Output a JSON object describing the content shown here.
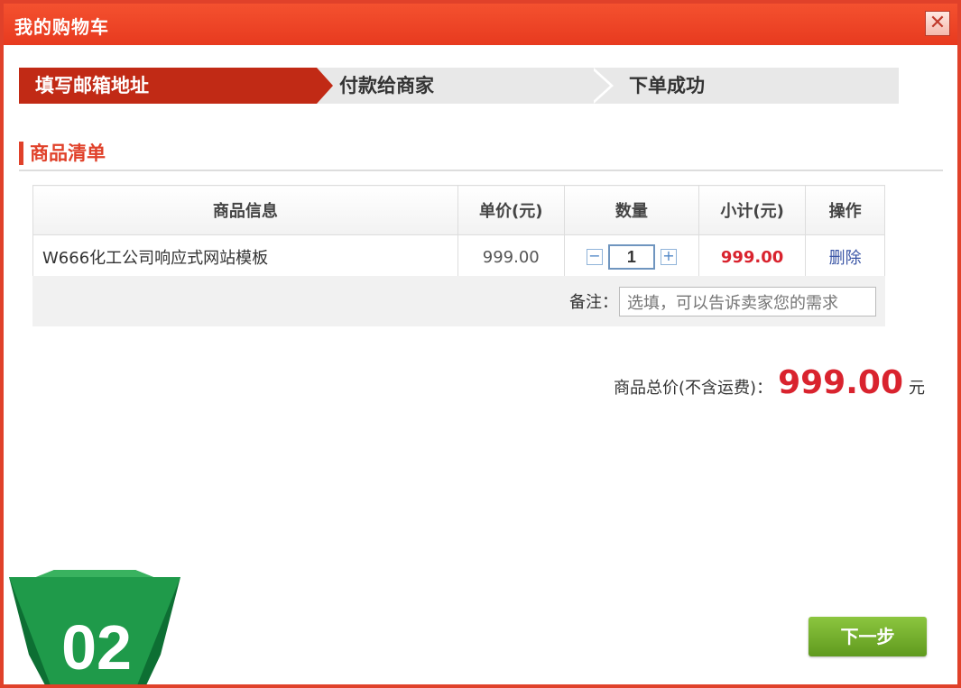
{
  "window": {
    "title": "我的购物车",
    "close_label": "✕"
  },
  "steps": [
    {
      "label": "填写邮箱地址",
      "active": true
    },
    {
      "label": "付款给商家",
      "active": false
    },
    {
      "label": "下单成功",
      "active": false
    }
  ],
  "section": {
    "title": "商品清单"
  },
  "table": {
    "headers": [
      "商品信息",
      "单价(元)",
      "数量",
      "小计(元)",
      "操作"
    ],
    "rows": [
      {
        "name": "W666化工公司响应式网站模板",
        "price": "999.00",
        "quantity": "1",
        "subtotal": "999.00",
        "action": "删除"
      }
    ],
    "qty_minus": "−",
    "qty_plus": "+"
  },
  "note": {
    "label": "备注：",
    "placeholder": "选填，可以告诉卖家您的需求"
  },
  "total": {
    "label": "商品总价(不含运费)：",
    "amount": "999.00",
    "unit": "元"
  },
  "next_button": "下一步",
  "badge": {
    "text": "02"
  },
  "colors": {
    "accent": "#e0412a",
    "active_step": "#c12a15",
    "price_red": "#d9232e",
    "next_green": "#6fa82a",
    "badge_green": "#1f9a4a"
  }
}
